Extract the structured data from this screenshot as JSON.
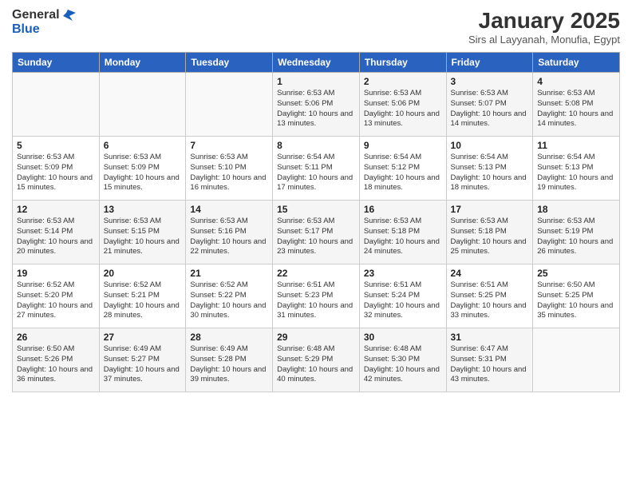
{
  "header": {
    "logo_line1": "General",
    "logo_line2": "Blue",
    "month": "January 2025",
    "location": "Sirs al Layyanah, Monufia, Egypt"
  },
  "weekdays": [
    "Sunday",
    "Monday",
    "Tuesday",
    "Wednesday",
    "Thursday",
    "Friday",
    "Saturday"
  ],
  "weeks": [
    [
      {
        "day": "",
        "info": ""
      },
      {
        "day": "",
        "info": ""
      },
      {
        "day": "",
        "info": ""
      },
      {
        "day": "1",
        "info": "Sunrise: 6:53 AM\nSunset: 5:06 PM\nDaylight: 10 hours\nand 13 minutes."
      },
      {
        "day": "2",
        "info": "Sunrise: 6:53 AM\nSunset: 5:06 PM\nDaylight: 10 hours\nand 13 minutes."
      },
      {
        "day": "3",
        "info": "Sunrise: 6:53 AM\nSunset: 5:07 PM\nDaylight: 10 hours\nand 14 minutes."
      },
      {
        "day": "4",
        "info": "Sunrise: 6:53 AM\nSunset: 5:08 PM\nDaylight: 10 hours\nand 14 minutes."
      }
    ],
    [
      {
        "day": "5",
        "info": "Sunrise: 6:53 AM\nSunset: 5:09 PM\nDaylight: 10 hours\nand 15 minutes."
      },
      {
        "day": "6",
        "info": "Sunrise: 6:53 AM\nSunset: 5:09 PM\nDaylight: 10 hours\nand 15 minutes."
      },
      {
        "day": "7",
        "info": "Sunrise: 6:53 AM\nSunset: 5:10 PM\nDaylight: 10 hours\nand 16 minutes."
      },
      {
        "day": "8",
        "info": "Sunrise: 6:54 AM\nSunset: 5:11 PM\nDaylight: 10 hours\nand 17 minutes."
      },
      {
        "day": "9",
        "info": "Sunrise: 6:54 AM\nSunset: 5:12 PM\nDaylight: 10 hours\nand 18 minutes."
      },
      {
        "day": "10",
        "info": "Sunrise: 6:54 AM\nSunset: 5:13 PM\nDaylight: 10 hours\nand 18 minutes."
      },
      {
        "day": "11",
        "info": "Sunrise: 6:54 AM\nSunset: 5:13 PM\nDaylight: 10 hours\nand 19 minutes."
      }
    ],
    [
      {
        "day": "12",
        "info": "Sunrise: 6:53 AM\nSunset: 5:14 PM\nDaylight: 10 hours\nand 20 minutes."
      },
      {
        "day": "13",
        "info": "Sunrise: 6:53 AM\nSunset: 5:15 PM\nDaylight: 10 hours\nand 21 minutes."
      },
      {
        "day": "14",
        "info": "Sunrise: 6:53 AM\nSunset: 5:16 PM\nDaylight: 10 hours\nand 22 minutes."
      },
      {
        "day": "15",
        "info": "Sunrise: 6:53 AM\nSunset: 5:17 PM\nDaylight: 10 hours\nand 23 minutes."
      },
      {
        "day": "16",
        "info": "Sunrise: 6:53 AM\nSunset: 5:18 PM\nDaylight: 10 hours\nand 24 minutes."
      },
      {
        "day": "17",
        "info": "Sunrise: 6:53 AM\nSunset: 5:18 PM\nDaylight: 10 hours\nand 25 minutes."
      },
      {
        "day": "18",
        "info": "Sunrise: 6:53 AM\nSunset: 5:19 PM\nDaylight: 10 hours\nand 26 minutes."
      }
    ],
    [
      {
        "day": "19",
        "info": "Sunrise: 6:52 AM\nSunset: 5:20 PM\nDaylight: 10 hours\nand 27 minutes."
      },
      {
        "day": "20",
        "info": "Sunrise: 6:52 AM\nSunset: 5:21 PM\nDaylight: 10 hours\nand 28 minutes."
      },
      {
        "day": "21",
        "info": "Sunrise: 6:52 AM\nSunset: 5:22 PM\nDaylight: 10 hours\nand 30 minutes."
      },
      {
        "day": "22",
        "info": "Sunrise: 6:51 AM\nSunset: 5:23 PM\nDaylight: 10 hours\nand 31 minutes."
      },
      {
        "day": "23",
        "info": "Sunrise: 6:51 AM\nSunset: 5:24 PM\nDaylight: 10 hours\nand 32 minutes."
      },
      {
        "day": "24",
        "info": "Sunrise: 6:51 AM\nSunset: 5:25 PM\nDaylight: 10 hours\nand 33 minutes."
      },
      {
        "day": "25",
        "info": "Sunrise: 6:50 AM\nSunset: 5:25 PM\nDaylight: 10 hours\nand 35 minutes."
      }
    ],
    [
      {
        "day": "26",
        "info": "Sunrise: 6:50 AM\nSunset: 5:26 PM\nDaylight: 10 hours\nand 36 minutes."
      },
      {
        "day": "27",
        "info": "Sunrise: 6:49 AM\nSunset: 5:27 PM\nDaylight: 10 hours\nand 37 minutes."
      },
      {
        "day": "28",
        "info": "Sunrise: 6:49 AM\nSunset: 5:28 PM\nDaylight: 10 hours\nand 39 minutes."
      },
      {
        "day": "29",
        "info": "Sunrise: 6:48 AM\nSunset: 5:29 PM\nDaylight: 10 hours\nand 40 minutes."
      },
      {
        "day": "30",
        "info": "Sunrise: 6:48 AM\nSunset: 5:30 PM\nDaylight: 10 hours\nand 42 minutes."
      },
      {
        "day": "31",
        "info": "Sunrise: 6:47 AM\nSunset: 5:31 PM\nDaylight: 10 hours\nand 43 minutes."
      },
      {
        "day": "",
        "info": ""
      }
    ]
  ]
}
